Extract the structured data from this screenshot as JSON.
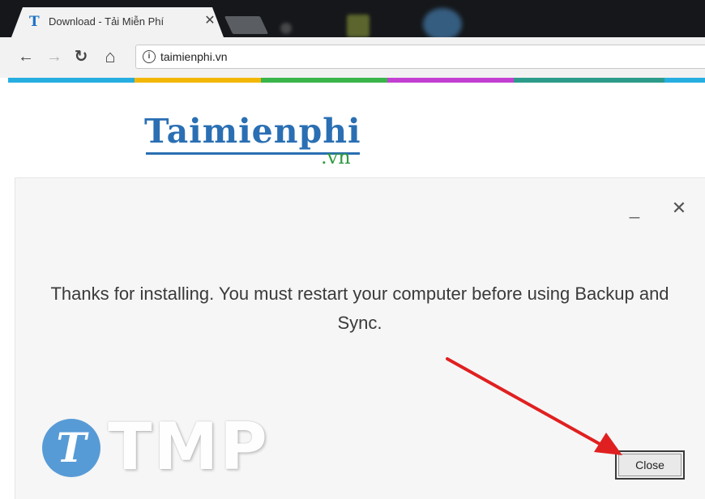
{
  "browser": {
    "tab_title": "Download - Tải Miễn Phí",
    "tab_favicon_letter": "T",
    "tab_close_glyph": "✕",
    "url": "taimienphi.vn",
    "nav": {
      "back_glyph": "←",
      "forward_glyph": "→",
      "reload_glyph": "↻",
      "home_glyph": "⌂",
      "info_glyph": "i"
    },
    "stripe_colors": [
      "#27aee0",
      "#f2b705",
      "#39b54a",
      "#c33fd1",
      "#2d9b8a",
      "#27aee0"
    ]
  },
  "logo": {
    "main": "Taimienphi",
    "suffix": ".vn",
    "main_color": "#2a6fb3",
    "suffix_color": "#2f9b3f"
  },
  "dialog": {
    "minimize_glyph": "_",
    "close_glyph": "✕",
    "message": "Thanks for installing. You must restart your computer before using Backup and Sync.",
    "close_button_label": "Close"
  },
  "watermark": {
    "letter": "T",
    "text": "TMP"
  },
  "annotation": {
    "arrow_color": "#e02020"
  },
  "icons": [
    "back-icon",
    "forward-icon",
    "reload-icon",
    "home-icon",
    "info-icon",
    "tab-close-icon",
    "minimize-icon",
    "close-icon",
    "arrow-annotation-icon"
  ]
}
